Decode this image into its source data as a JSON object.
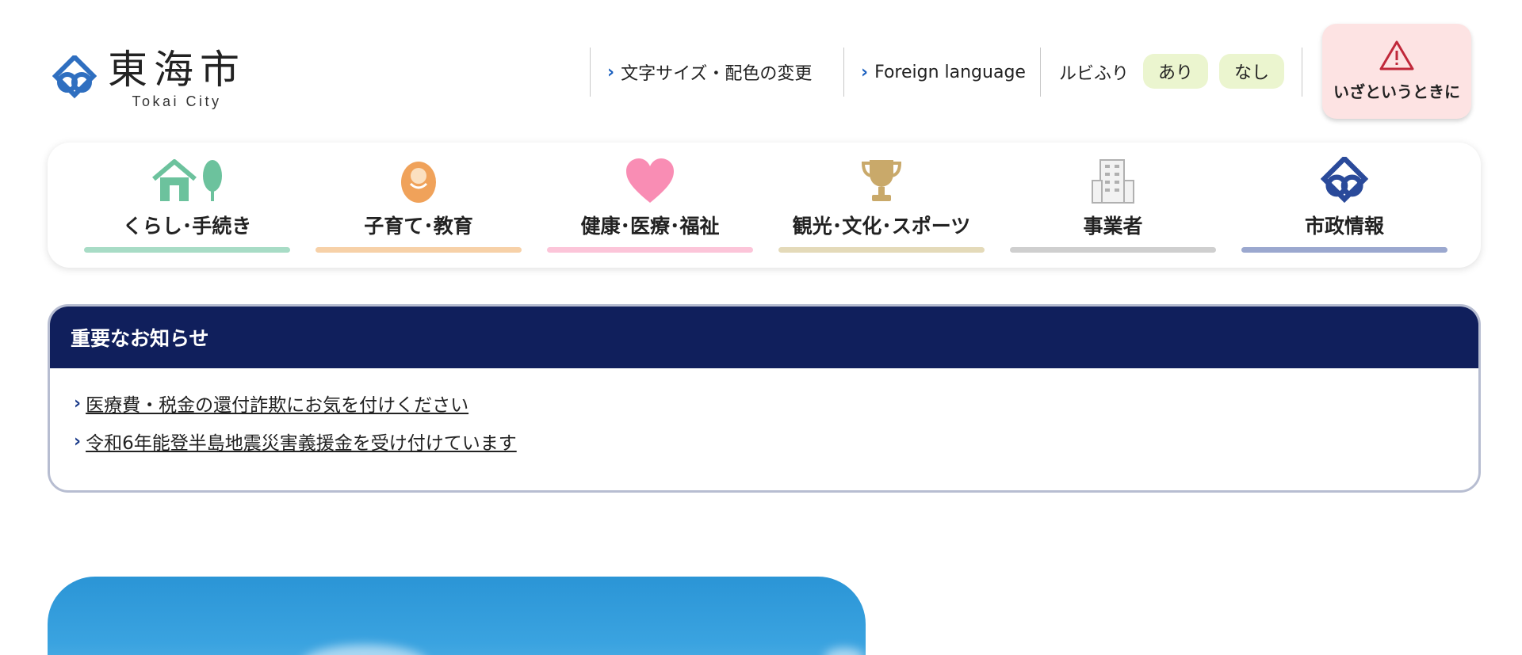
{
  "header": {
    "logo_jp": "東海市",
    "logo_en": "Tokai City",
    "utility": {
      "text_size_color": "文字サイズ・配色の変更",
      "foreign_language": "Foreign language",
      "ruby_label": "ルビふり",
      "ruby_on": "あり",
      "ruby_off": "なし"
    },
    "emergency": "いざというときに"
  },
  "nav": {
    "items": [
      {
        "label": "くらし･手続き",
        "icon": "house-tree-icon",
        "color": "#a8dcc6"
      },
      {
        "label": "子育て･教育",
        "icon": "baby-icon",
        "color": "#f7d1a8"
      },
      {
        "label": "健康･医療･福祉",
        "icon": "heart-icon",
        "color": "#fcc5d9"
      },
      {
        "label": "観光･文化･スポーツ",
        "icon": "trophy-icon",
        "color": "#e4dab9"
      },
      {
        "label": "事業者",
        "icon": "building-icon",
        "color": "#cfcfcf"
      },
      {
        "label": "市政情報",
        "icon": "city-emblem-icon",
        "color": "#9ba8cf"
      }
    ]
  },
  "notice": {
    "title": "重要なお知らせ",
    "items": [
      "医療費・税金の還付詐欺にお気を付けください",
      "令和6年能登半島地震災害義援金を受け付けています"
    ]
  },
  "colors": {
    "notice_header": "#101f5c",
    "accent_link": "#1a5fbf",
    "emergency_bg": "#fde3e3",
    "ruby_btn_bg": "#ebf5cf"
  }
}
